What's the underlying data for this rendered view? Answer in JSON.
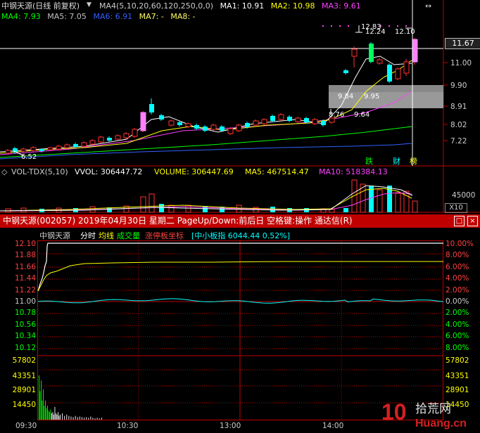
{
  "colors": {
    "up": "#ff3232",
    "down": "#00ffff",
    "ma1": "#ffffff",
    "ma2": "#ffff00",
    "ma3": "#ff00ff",
    "ma4": "#00ff00",
    "ma5": "#c0c0c0",
    "ma6": "#3060ff",
    "title_bar": "#c00000"
  },
  "kline": {
    "title": "中钢天源(日线 前复权)",
    "indicator": "MA4(5,10,20,60,120,250,0,0)",
    "ma1": "MA1: 10.91",
    "ma2": "MA2: 10.98",
    "ma3": "MA3: 9.61",
    "ma4": "MA4: 7.93",
    "ma5": "MA5: 7.05",
    "ma6": "MA6: 6.91",
    "ma7": "MA7: -",
    "ma8": "MA8: -",
    "price_axis": [
      "11.00",
      "9.90",
      "8.91",
      "8.02",
      "7.22"
    ],
    "current_price": "11.67",
    "annotations": {
      "high_a": "12.83",
      "high_b": "12.24",
      "high_c": "12.10",
      "low_a": "9.84",
      "low_b": "9.95",
      "low_c": "8.76",
      "low_d": "9.64",
      "low_start": "6.52"
    },
    "badges": {
      "b1": "跌",
      "b2": "财",
      "b3": "榜"
    }
  },
  "volume": {
    "indicator": "VOL-TDX(5,10)",
    "vvol": "VVOL: 306447.72",
    "volume": "VOLUME: 306447.69",
    "ma5": "MA5: 467514.47",
    "ma10": "MA10: 518384.13",
    "axis": "45000",
    "multiplier": "X10"
  },
  "window": {
    "title": "中钢天源(002057) 2019年04月30日 星期二 PageUp/Down:前后日 空格键:操作 通达信(R)",
    "btn_restore": "□",
    "btn_close": "×"
  },
  "intraday": {
    "tabs": {
      "name": "中钢天源",
      "minute": "分时",
      "avg": "均线",
      "volume": "成交量",
      "limit": "涨停板坐标",
      "index": "[中小板指 6044.44 0.52%]"
    },
    "price_axis": [
      "12.10",
      "11.88",
      "11.66",
      "11.44",
      "11.22",
      "11.00",
      "10.78",
      "10.56",
      "10.34",
      "10.12"
    ],
    "pct_axis": [
      "10.00%",
      "8.00%",
      "6.00%",
      "4.00%",
      "2.00%",
      "0.00%",
      "2.00%",
      "4.00%",
      "6.00%",
      "8.00%"
    ],
    "vol_axis": [
      "57802",
      "43351",
      "28901",
      "14450"
    ],
    "vol_axis_right": [
      "57802",
      "43351",
      "28901",
      "14450"
    ],
    "time_axis": [
      "09:30",
      "10:30",
      "13:00",
      "14:00"
    ]
  },
  "logo": {
    "num": "10",
    "cn": "拾荒网",
    "site": "Huang.cn"
  }
}
